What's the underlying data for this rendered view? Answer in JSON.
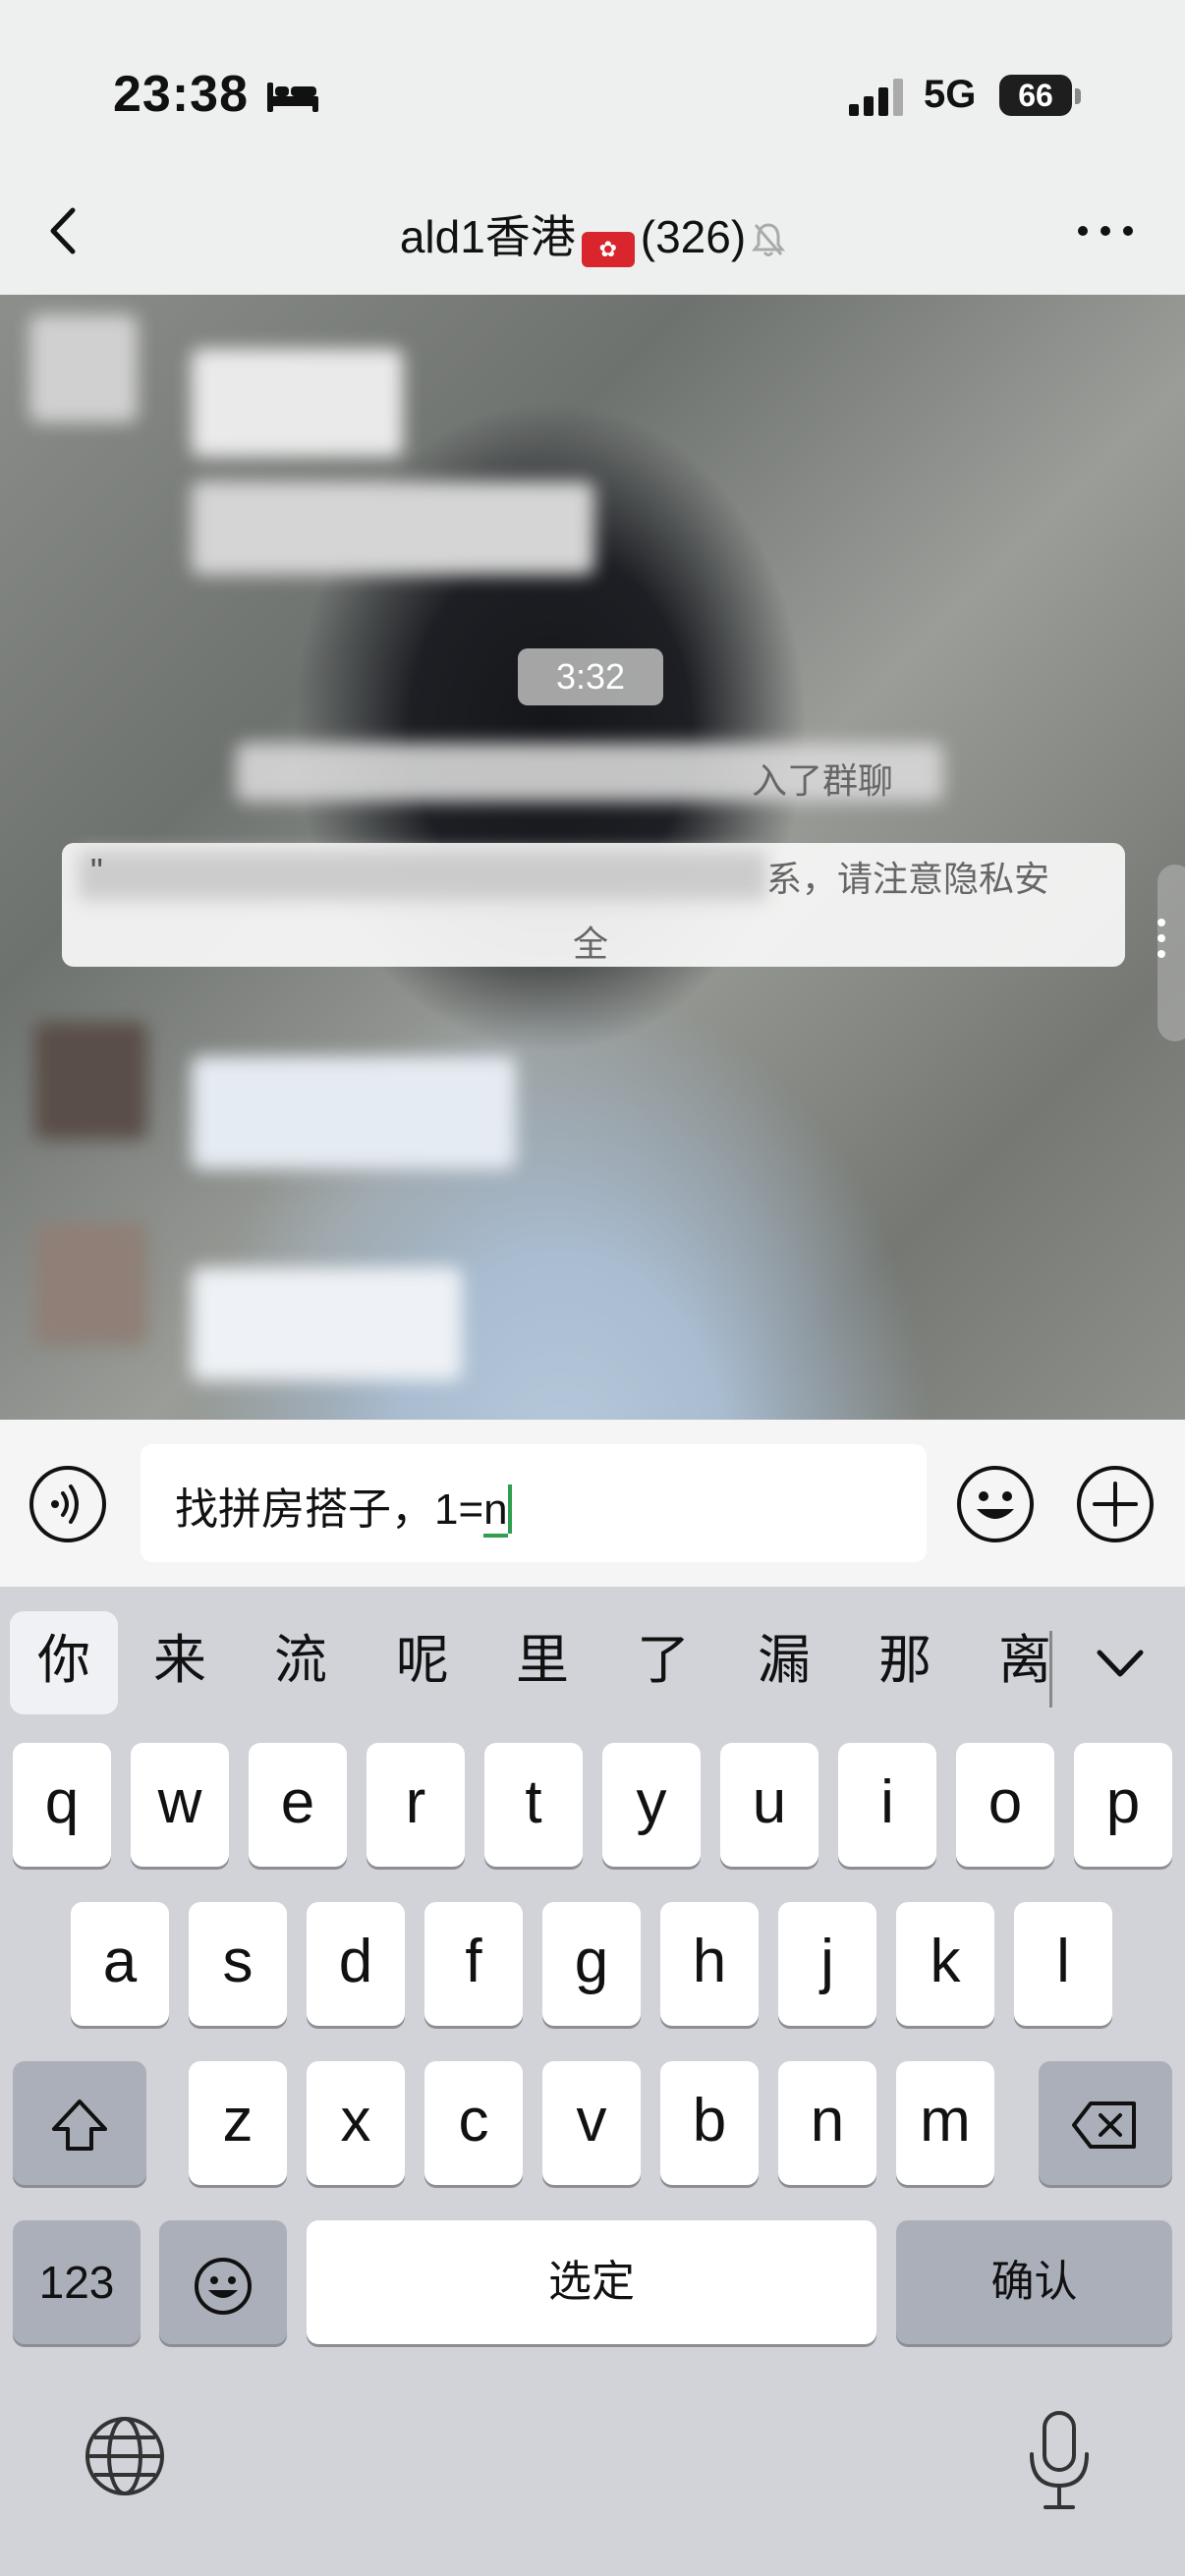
{
  "status_bar": {
    "time": "23:38",
    "network": "5G",
    "battery": "66"
  },
  "nav": {
    "title": "ald1香港",
    "flag_glyph": "✿",
    "member_count": "(326)"
  },
  "chat": {
    "time_chip": "3:32",
    "join_notice_tail": "入了群聊",
    "privacy_line1_head": "\"",
    "privacy_line1_tail": "系，请注意隐私安",
    "privacy_line2": "全"
  },
  "input": {
    "text": "找拼房搭子，1=",
    "composing": "n"
  },
  "keyboard": {
    "candidates": [
      "你",
      "来",
      "流",
      "呢",
      "里",
      "了",
      "漏",
      "那",
      "离"
    ],
    "row1": [
      "q",
      "w",
      "e",
      "r",
      "t",
      "y",
      "u",
      "i",
      "o",
      "p"
    ],
    "row2": [
      "a",
      "s",
      "d",
      "f",
      "g",
      "h",
      "j",
      "k",
      "l"
    ],
    "row3": [
      "z",
      "x",
      "c",
      "v",
      "b",
      "n",
      "m"
    ],
    "numbers_key": "123",
    "space_key": "选定",
    "return_key": "确认"
  },
  "colors": {
    "accent_green": "#2f9e4f",
    "keyboard_bg": "#d1d3d9",
    "dark_key": "#abafb9"
  }
}
